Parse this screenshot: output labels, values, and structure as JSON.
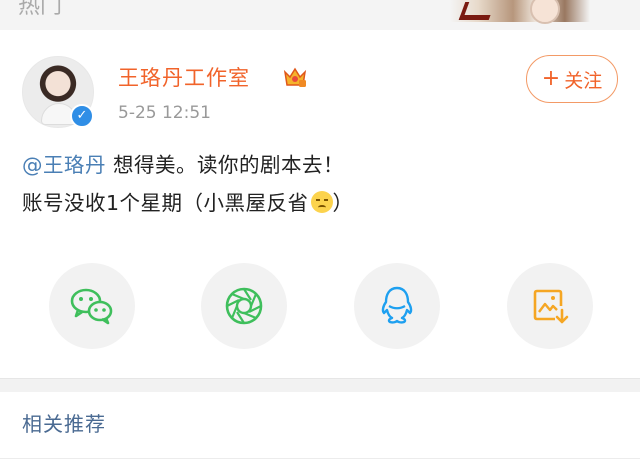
{
  "topbar": {
    "label": "热门"
  },
  "post": {
    "author": "王珞丹工作室",
    "timestamp": "5-25 12:51",
    "follow_label": "关注",
    "mention": "@王珞丹",
    "line1_rest": " 想得美。读你的剧本去！",
    "line2_prefix": "账号没收1个星期（小黑屋反省",
    "line2_suffix": "）",
    "emoji_icon": "cold-sweat-emoji-icon"
  },
  "share_targets": [
    {
      "name": "wechat",
      "icon": "wechat-icon",
      "color": "#3fbf5c"
    },
    {
      "name": "moments",
      "icon": "wechat-moments-icon",
      "color": "#3fbf5c"
    },
    {
      "name": "qq",
      "icon": "qq-icon",
      "color": "#1ea0f0"
    },
    {
      "name": "save-image",
      "icon": "save-image-icon",
      "color": "#f5a623"
    }
  ],
  "related": {
    "label": "相关推荐"
  },
  "colors": {
    "accent": "#f1632a",
    "link": "#4a7fb5",
    "verified": "#2f8ee6"
  }
}
